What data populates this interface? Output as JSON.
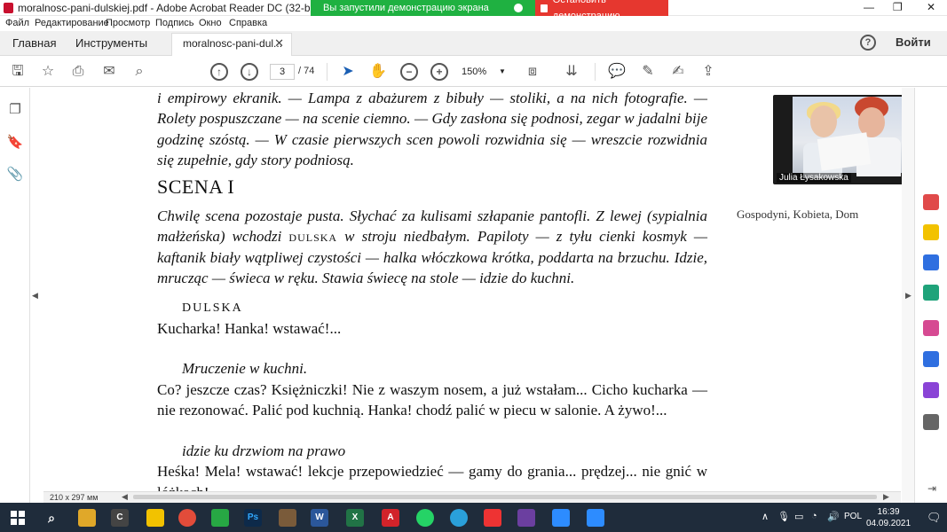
{
  "window": {
    "title": "moralnosc-pani-dulskiej.pdf - Adobe Acrobat Reader DC (32-bit)",
    "share_status": "Вы запустили демонстрацию экрана",
    "stop_share": "Остановить демонстрацию"
  },
  "menu": [
    "Файл",
    "Редактирование",
    "Просмотр",
    "Подпись",
    "Окно",
    "Справка"
  ],
  "tabs": {
    "home": "Главная",
    "tools": "Инструменты",
    "document": "moralnosc-pani-dul...",
    "login": "Войти"
  },
  "toolbar": {
    "current_page": "3",
    "total_pages": "/ 74",
    "zoom": "150%"
  },
  "document": {
    "stage_top": "i empirowy ekranik. — Lampa z abażurem z bibuły — stoliki, a na nich fotografie. — Rolety pospuszczane — na scenie ciemno. — Gdy zasłona się podnosi, zegar w jadalni bije godzinę szóstą. — W czasie pierwszych scen powoli rozwidnia się — wreszcie rozwidnia się zupełnie, gdy story podniosą.",
    "scene_title": "SCENA I",
    "stage_intro_a": "Chwilę scena pozostaje pusta. Słychać za kulisami szłapanie pantofli. Z lewej (sypialnia małżeńska) wchodzi ",
    "stage_intro_name": "dulska",
    "stage_intro_b": " w stroju niedbałym. Papiloty — z tyłu cienki kosmyk — kaftanik biały wątpliwej czystości — halka włóczkowa krótka, poddarta na brzuchu. Idzie, mrucząc — świeca w ręku. Stawia świecę na stole — idzie do kuchni.",
    "speaker": "DULSKA",
    "line1": "Kucharka! Hanka! wstawać!...",
    "dir1": "Mruczenie w kuchni.",
    "line2": "Co? jeszcze czas? Księżniczki! Nie z waszym nosem, a już wstałam... Cicho kucharka — nie rezonować. Palić pod kuchnią. Hanka! chodź palić w piecu w salonie. A żywo!...",
    "dir2": "idzie ku drzwiom na prawo",
    "line3": "Heśka! Mela! wstawać! lekcje przepowiedzieć — gamy do grania... prędzej... nie gnić w łóżkach!...",
    "tags": "Gospodyni, Kobieta, Dom",
    "page_size": "210 x 297 мм"
  },
  "video": {
    "participant": "Julia Łysakowska"
  },
  "taskbar": {
    "language": "POL",
    "time": "16:39",
    "date": "04.09.2021"
  }
}
